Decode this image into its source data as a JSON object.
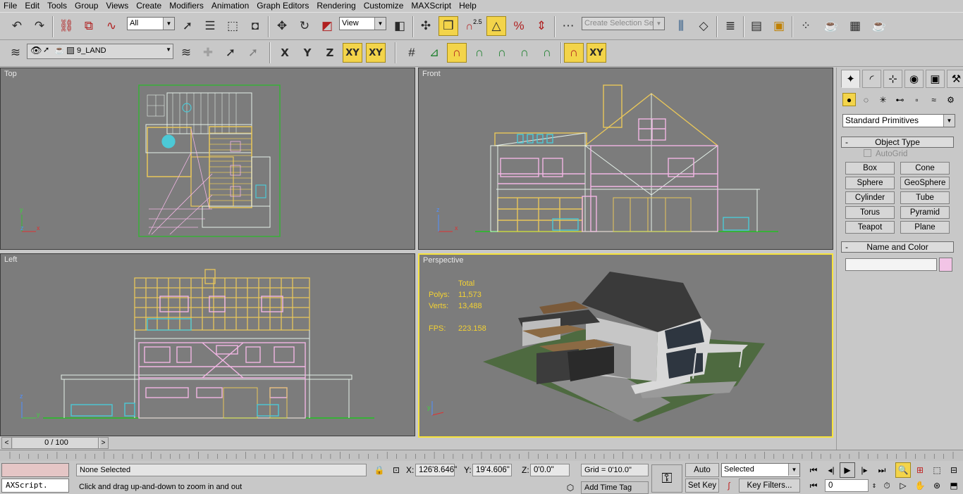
{
  "menu": [
    "File",
    "Edit",
    "Tools",
    "Group",
    "Views",
    "Create",
    "Modifiers",
    "Animation",
    "Graph Editors",
    "Rendering",
    "Customize",
    "MAXScript",
    "Help"
  ],
  "toolbar": {
    "selection_filter": "All",
    "ref_coord": "View",
    "snap_angle": "2.5",
    "named_selection_placeholder": "Create Selection Set",
    "layer": "9_LAND",
    "axis_x": "X",
    "axis_y": "Y",
    "axis_z": "Z",
    "axis_xy": "XY",
    "axis_xy2": "XY"
  },
  "viewports": {
    "top": "Top",
    "front": "Front",
    "left": "Left",
    "perspective": "Perspective"
  },
  "stats": {
    "header": "Total",
    "polys_label": "Polys:",
    "polys_value": "11,573",
    "verts_label": "Verts:",
    "verts_value": "13,488",
    "fps_label": "FPS:",
    "fps_value": "223.158"
  },
  "axes": {
    "x": "x",
    "y": "y",
    "z": "z"
  },
  "command_panel": {
    "category": "Standard Primitives",
    "object_type_title": "Object Type",
    "autogrid": "AutoGrid",
    "buttons": [
      "Box",
      "Cone",
      "Sphere",
      "GeoSphere",
      "Cylinder",
      "Tube",
      "Torus",
      "Pyramid",
      "Teapot",
      "Plane"
    ],
    "name_color_title": "Name and Color",
    "swatch_color": "#f2c4e6"
  },
  "timeline": {
    "frame": "0 / 100",
    "ticks_max": 100
  },
  "status": {
    "maxscript_label": "AXScript.",
    "selection": "None Selected",
    "prompt": "Click and drag up-and-down to zoom in and out",
    "x_label": "X:",
    "x_value": "126'8.646\"",
    "y_label": "Y:",
    "y_value": "19'4.606\"",
    "z_label": "Z:",
    "z_value": "0'0.0\"",
    "grid": "Grid = 0'10.0\"",
    "add_time_tag": "Add Time Tag",
    "auto_key": "Auto Key",
    "set_key": "Set Key",
    "key_mode": "Selected",
    "key_filters": "Key Filters...",
    "current_frame": "0"
  },
  "colors": {
    "viewport_bg": "#7c7c7c",
    "active_border": "#f7e33c",
    "wire_yellow": "#e8c65a",
    "wire_pink": "#f2b6e4",
    "wire_cyan": "#4cc9d6",
    "wire_white": "#e4f0e8",
    "wire_green": "#38b038"
  }
}
